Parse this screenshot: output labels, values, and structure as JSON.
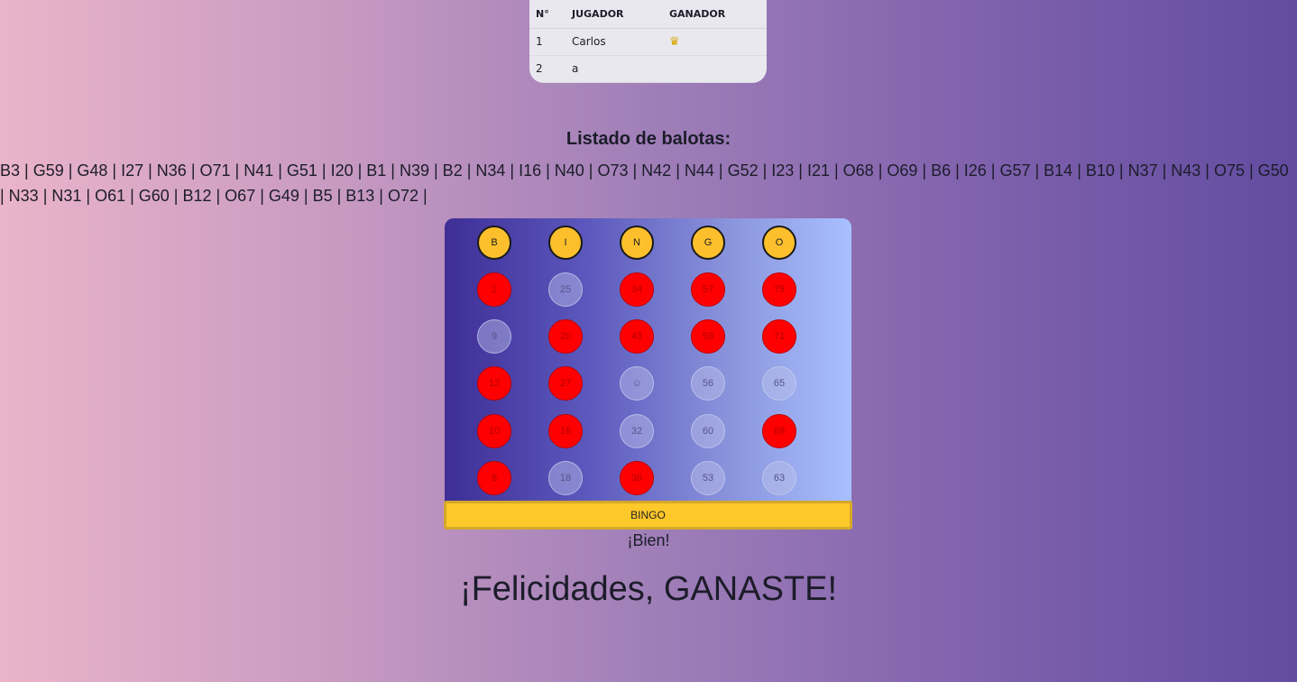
{
  "players_table": {
    "headers": [
      "N°",
      "JUGADOR",
      "GANADOR"
    ],
    "rows": [
      {
        "num": "1",
        "name": "Carlos",
        "winner": "♛"
      },
      {
        "num": "2",
        "name": "a",
        "winner": ""
      }
    ]
  },
  "balls_title": "Listado de balotas:",
  "balls_list": "B3 | G59 | G48 | I27 | N36 | O71 | N41 | G51 | I20 | B1 | N39 | B2 | N34 | I16 | N40 | O73 | N42 | N44 | G52 | I23 | I21 | O68 | O69 | B6 | I26 | G57 | B14 | B10 | N37 | N43 | O75 | G50 | N33 | N31 | O61 | G60 | B12 | O67 | G49 | B5 | B13 | O72 |",
  "card": {
    "headers": [
      "B",
      "I",
      "N",
      "G",
      "O"
    ],
    "rows": [
      [
        {
          "v": "2",
          "m": true
        },
        {
          "v": "25",
          "m": false
        },
        {
          "v": "34",
          "m": true
        },
        {
          "v": "57",
          "m": true
        },
        {
          "v": "75",
          "m": true
        }
      ],
      [
        {
          "v": "9",
          "m": false
        },
        {
          "v": "20",
          "m": true
        },
        {
          "v": "43",
          "m": true
        },
        {
          "v": "59",
          "m": true
        },
        {
          "v": "71",
          "m": true
        }
      ],
      [
        {
          "v": "12",
          "m": true
        },
        {
          "v": "27",
          "m": true
        },
        {
          "v": "☺",
          "m": false
        },
        {
          "v": "56",
          "m": false
        },
        {
          "v": "65",
          "m": false
        }
      ],
      [
        {
          "v": "10",
          "m": true
        },
        {
          "v": "16",
          "m": true
        },
        {
          "v": "32",
          "m": false
        },
        {
          "v": "60",
          "m": false
        },
        {
          "v": "69",
          "m": true
        }
      ],
      [
        {
          "v": "6",
          "m": true
        },
        {
          "v": "18",
          "m": false
        },
        {
          "v": "36",
          "m": true
        },
        {
          "v": "53",
          "m": false
        },
        {
          "v": "63",
          "m": false
        }
      ]
    ]
  },
  "bingo_button": "BINGO",
  "status_text": "¡Bien!",
  "winner_text": "¡Felicidades, GANASTE!",
  "colors": {
    "marked": "#ff0000",
    "header_ball": "#fdc02c",
    "button": "#fdc82a"
  }
}
